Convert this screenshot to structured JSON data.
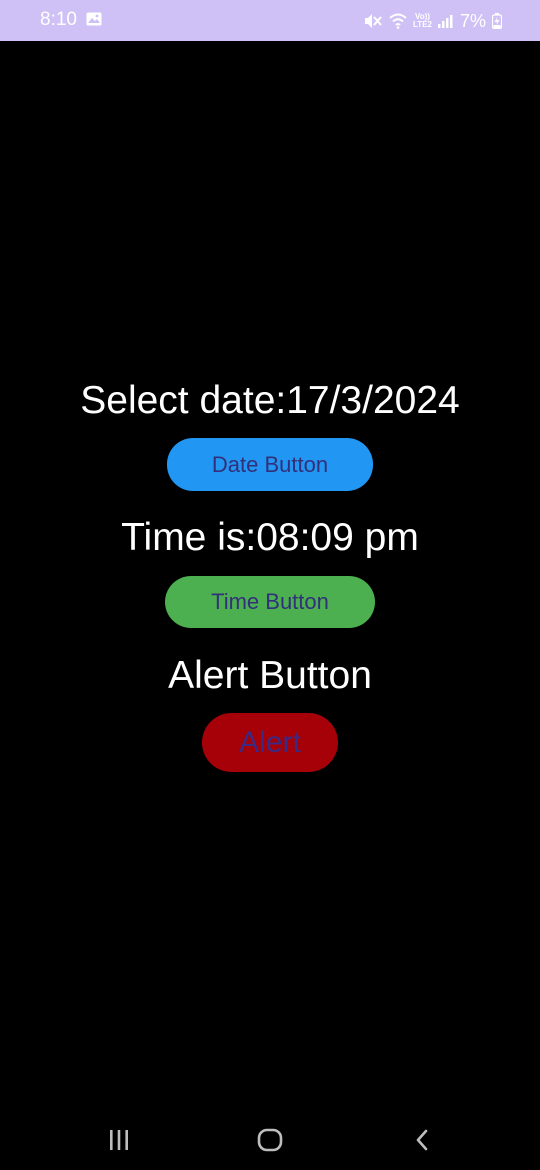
{
  "status_bar": {
    "time": "8:10",
    "battery": "7%",
    "volte_line1": "Vo))",
    "volte_line2": "LTE2",
    "icons": [
      "gallery-icon",
      "mute-icon",
      "wifi-icon",
      "volte-icon",
      "signal-icon",
      "battery-charging-icon"
    ]
  },
  "main": {
    "date_text": "Select date:17/3/2024",
    "date_button": "Date Button",
    "time_text": "Time is:08:09 pm",
    "time_button": "Time Button",
    "alert_text": "Alert Button",
    "alert_button": "Alert"
  },
  "nav_bar": {
    "icons": [
      "recent-apps-icon",
      "home-icon",
      "back-icon"
    ]
  },
  "colors": {
    "status_bar_bg": "#cfc1f6",
    "background": "#000000",
    "date_button_bg": "#2196f3",
    "time_button_bg": "#4caf50",
    "alert_button_bg": "#a60009",
    "button_text": "#32307a"
  }
}
